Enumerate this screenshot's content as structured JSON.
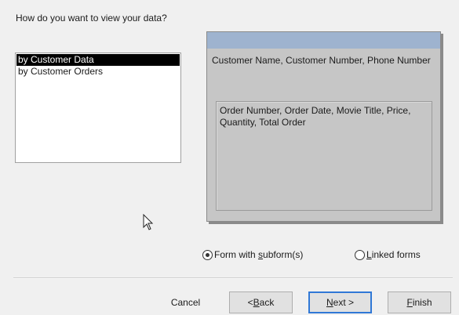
{
  "question": "How do you want to view your data?",
  "view_options": [
    "by Customer Data",
    "by Customer Orders"
  ],
  "selected_view": "by Customer Data",
  "preview": {
    "main_fields": "Customer Name, Customer Number, Phone Number",
    "sub_fields": "Order Number, Order Date, Movie Title, Price, Quantity, Total Order"
  },
  "radios": {
    "subform": {
      "pre": "Form with ",
      "key": "s",
      "post": "ubform(s)",
      "checked": true
    },
    "linked": {
      "pre": "",
      "key": "L",
      "post": "inked forms",
      "checked": false
    }
  },
  "buttons": {
    "cancel": "Cancel",
    "back": {
      "pre": "< ",
      "key": "B",
      "post": "ack"
    },
    "next": {
      "pre": "",
      "key": "N",
      "post": "ext >"
    },
    "finish": {
      "pre": "",
      "key": "F",
      "post": "inish"
    }
  },
  "colors": {
    "preview_header": "#9eb3cf",
    "default_button_border": "#3078d6"
  },
  "icons": {
    "cursor": "arrow-pointer-icon"
  }
}
